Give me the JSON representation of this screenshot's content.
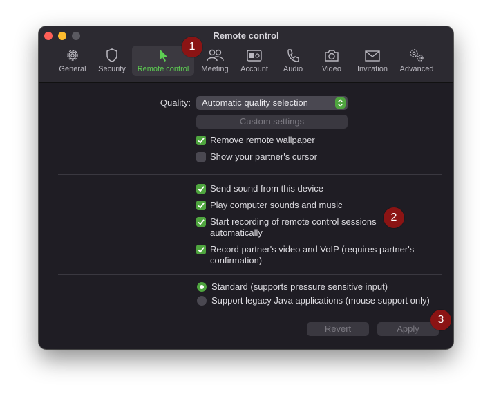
{
  "window": {
    "title": "Remote control"
  },
  "tabs": [
    {
      "label": "General",
      "icon": "gear-icon"
    },
    {
      "label": "Security",
      "icon": "shield-icon"
    },
    {
      "label": "Remote control",
      "icon": "cursor-icon",
      "active": true
    },
    {
      "label": "Meeting",
      "icon": "people-icon"
    },
    {
      "label": "Account",
      "icon": "id-card-icon"
    },
    {
      "label": "Audio",
      "icon": "phone-icon"
    },
    {
      "label": "Video",
      "icon": "camera-icon"
    },
    {
      "label": "Invitation",
      "icon": "envelope-icon"
    },
    {
      "label": "Advanced",
      "icon": "gears-icon"
    }
  ],
  "quality": {
    "label": "Quality:",
    "value": "Automatic quality selection",
    "custom_settings_label": "Custom settings"
  },
  "checkboxes": [
    {
      "label": "Remove remote wallpaper",
      "checked": true
    },
    {
      "label": "Show your partner's cursor",
      "checked": false
    },
    {
      "label": "Send sound from this device",
      "checked": true
    },
    {
      "label": "Play computer sounds and music",
      "checked": true
    },
    {
      "label_line1": "Start recording of remote control sessions",
      "label_line2": "automatically",
      "checked": true
    },
    {
      "label_line1": "Record partner's video and VoIP (requires partner's",
      "label_line2": "confirmation)",
      "checked": true
    }
  ],
  "input_mode": [
    {
      "label": "Standard (supports pressure sensitive input)",
      "selected": true
    },
    {
      "label": "Support legacy Java applications (mouse support only)",
      "selected": false
    }
  ],
  "buttons": {
    "revert": "Revert",
    "apply": "Apply"
  },
  "badges": [
    "1",
    "2",
    "3"
  ],
  "colors": {
    "accent": "#5dcf52",
    "checkbox": "#4fa53f",
    "badge": "#8b1414",
    "background": "#1f1d24"
  }
}
